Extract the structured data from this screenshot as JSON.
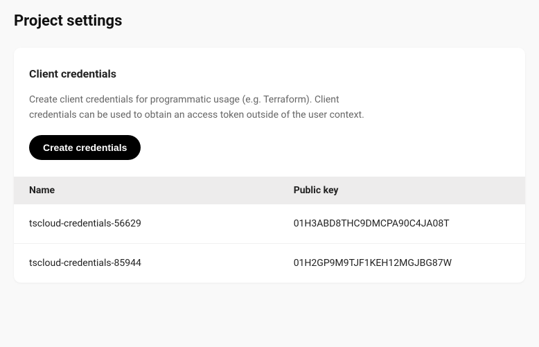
{
  "page": {
    "title": "Project settings"
  },
  "section": {
    "title": "Client credentials",
    "description": "Create client credentials for programmatic usage (e.g. Terraform). Client credentials can be used to obtain an access token outside of the user context.",
    "create_button_label": "Create credentials"
  },
  "table": {
    "headers": {
      "name": "Name",
      "public_key": "Public key"
    },
    "rows": [
      {
        "name": "tscloud-credentials-56629",
        "public_key": "01H3ABD8THC9DMCPA90C4JA08T"
      },
      {
        "name": "tscloud-credentials-85944",
        "public_key": "01H2GP9M9TJF1KEH12MGJBG87W"
      }
    ]
  }
}
